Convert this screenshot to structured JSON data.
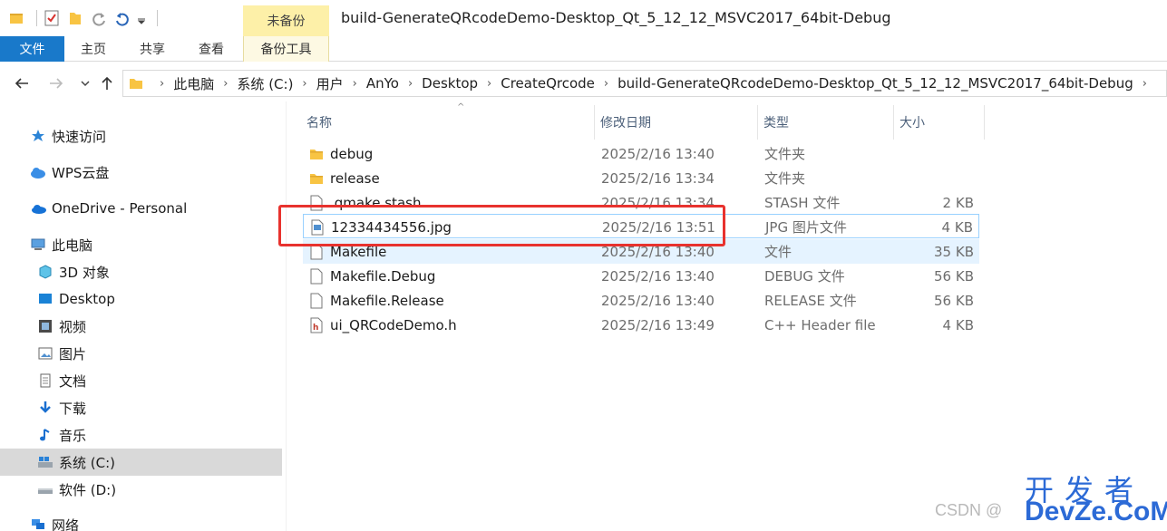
{
  "window": {
    "title": "build-GenerateQRcodeDemo-Desktop_Qt_5_12_12_MSVC2017_64bit-Debug",
    "context_tab_header": "未备份"
  },
  "ribbon": {
    "tabs": [
      {
        "label": "文件",
        "active": true
      },
      {
        "label": "主页"
      },
      {
        "label": "共享"
      },
      {
        "label": "查看"
      },
      {
        "label": "备份工具"
      }
    ]
  },
  "address": {
    "crumbs": [
      "此电脑",
      "系统 (C:)",
      "用户",
      "AnYo",
      "Desktop",
      "CreateQrcode",
      "build-GenerateQRcodeDemo-Desktop_Qt_5_12_12_MSVC2017_64bit-Debug"
    ]
  },
  "nav": {
    "items": [
      {
        "label": "快速访问",
        "icon": "star-icon"
      },
      {
        "label": "WPS云盘",
        "icon": "cloud-icon"
      },
      {
        "label": "OneDrive - Personal",
        "icon": "onedrive-icon"
      },
      {
        "label": "此电脑",
        "icon": "computer-icon"
      },
      {
        "label": "3D 对象",
        "icon": "cube-icon"
      },
      {
        "label": "Desktop",
        "icon": "desktop-icon"
      },
      {
        "label": "视频",
        "icon": "film-icon"
      },
      {
        "label": "图片",
        "icon": "picture-icon"
      },
      {
        "label": "文档",
        "icon": "document-icon"
      },
      {
        "label": "下载",
        "icon": "download-icon"
      },
      {
        "label": "音乐",
        "icon": "music-icon"
      },
      {
        "label": "系统 (C:)",
        "icon": "drive-c-icon",
        "selected": true
      },
      {
        "label": "软件 (D:)",
        "icon": "drive-d-icon"
      },
      {
        "label": "网络",
        "icon": "network-icon"
      }
    ]
  },
  "columns": {
    "name": "名称",
    "date": "修改日期",
    "type": "类型",
    "size": "大小"
  },
  "files": [
    {
      "name": "debug",
      "date": "2025/2/16 13:40",
      "type": "文件夹",
      "size": "",
      "icon": "folder-icon"
    },
    {
      "name": "release",
      "date": "2025/2/16 13:34",
      "type": "文件夹",
      "size": "",
      "icon": "folder-icon"
    },
    {
      "name": ".qmake.stash",
      "date": "2025/2/16 13:34",
      "type": "STASH 文件",
      "size": "2 KB",
      "icon": "file-icon"
    },
    {
      "name": "12334434556.jpg",
      "date": "2025/2/16 13:51",
      "type": "JPG 图片文件",
      "size": "4 KB",
      "icon": "image-file-icon",
      "state": "selected"
    },
    {
      "name": "Makefile",
      "date": "2025/2/16 13:40",
      "type": "文件",
      "size": "35 KB",
      "icon": "file-icon",
      "state": "hover"
    },
    {
      "name": "Makefile.Debug",
      "date": "2025/2/16 13:40",
      "type": "DEBUG 文件",
      "size": "56 KB",
      "icon": "file-icon"
    },
    {
      "name": "Makefile.Release",
      "date": "2025/2/16 13:40",
      "type": "RELEASE 文件",
      "size": "56 KB",
      "icon": "file-icon"
    },
    {
      "name": "ui_QRCodeDemo.h",
      "date": "2025/2/16 13:49",
      "type": "C++ Header file",
      "size": "4 KB",
      "icon": "header-file-icon"
    }
  ],
  "watermark": {
    "csdn": "CSDN @",
    "line1": "开发者",
    "line2": "DevZe.CoM"
  },
  "colors": {
    "accent": "#1979ca",
    "highlight": "#e8322e",
    "folder": "#f8c443",
    "selection_border": "#99d1ff",
    "hover_bg": "#e5f3ff"
  }
}
